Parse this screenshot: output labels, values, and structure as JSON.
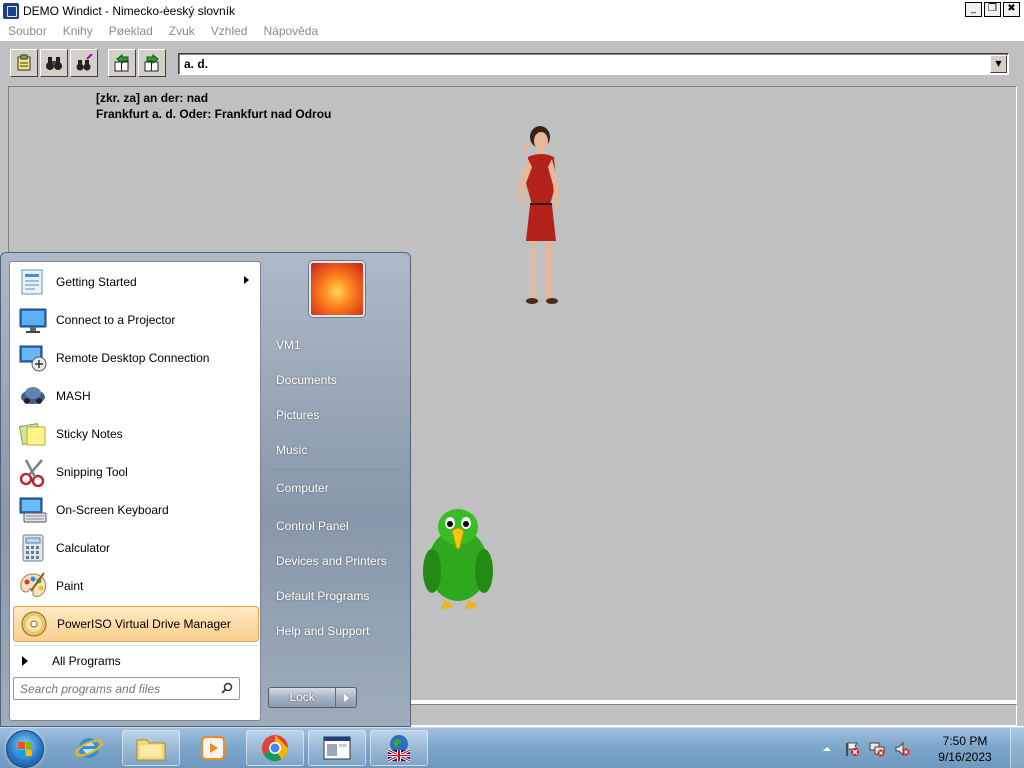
{
  "window": {
    "title": "DEMO Windict - Nimecko-èeský slovník",
    "minimize": "_",
    "restore": "❐",
    "close": "✖"
  },
  "menu": [
    "Soubor",
    "Knihy",
    "Pøeklad",
    "Zvuk",
    "Vzhled",
    "Nápověda"
  ],
  "toolbar": {
    "search_value": "a. d.",
    "buttons": [
      "clipboard-icon",
      "binoculars-icon",
      "binoculars-magic-icon",
      "book-back-icon",
      "book-forward-icon"
    ]
  },
  "definition": {
    "lines": [
      "[zkr. za] an der: nad",
      "Frankfurt a. d. Oder: Frankfurt nad Odrou"
    ]
  },
  "start_menu": {
    "programs": [
      {
        "label": "Getting Started",
        "icon": "getting-started-icon",
        "has_submenu": true
      },
      {
        "label": "Connect to a Projector",
        "icon": "projector-icon"
      },
      {
        "label": "Remote Desktop Connection",
        "icon": "remote-desktop-icon"
      },
      {
        "label": "MASH",
        "icon": "mash-icon"
      },
      {
        "label": "Sticky Notes",
        "icon": "sticky-notes-icon"
      },
      {
        "label": "Snipping Tool",
        "icon": "scissors-icon"
      },
      {
        "label": "On-Screen Keyboard",
        "icon": "keyboard-icon"
      },
      {
        "label": "Calculator",
        "icon": "calculator-icon"
      },
      {
        "label": "Paint",
        "icon": "paint-palette-icon"
      },
      {
        "label": "PowerISO Virtual Drive Manager",
        "icon": "disc-icon",
        "highlighted": true
      }
    ],
    "all_programs": "All Programs",
    "search_placeholder": "Search programs and files",
    "right_links": [
      "VM1",
      "Documents",
      "Pictures",
      "Music",
      "Computer",
      "Control Panel",
      "Devices and Printers",
      "Default Programs",
      "Help and Support"
    ],
    "lock": "Lock"
  },
  "taskbar": {
    "time": "7:50 PM",
    "date": "9/16/2023",
    "apps": [
      "internet-explorer-icon",
      "file-explorer-icon",
      "media-player-icon",
      "chrome-icon",
      "windict-window-icon",
      "windict-globe-icon"
    ]
  },
  "colors": {
    "window_bg": "#c0c0c0",
    "highlight": "#f9cf8c",
    "taskbar": "#7ea7cc"
  }
}
